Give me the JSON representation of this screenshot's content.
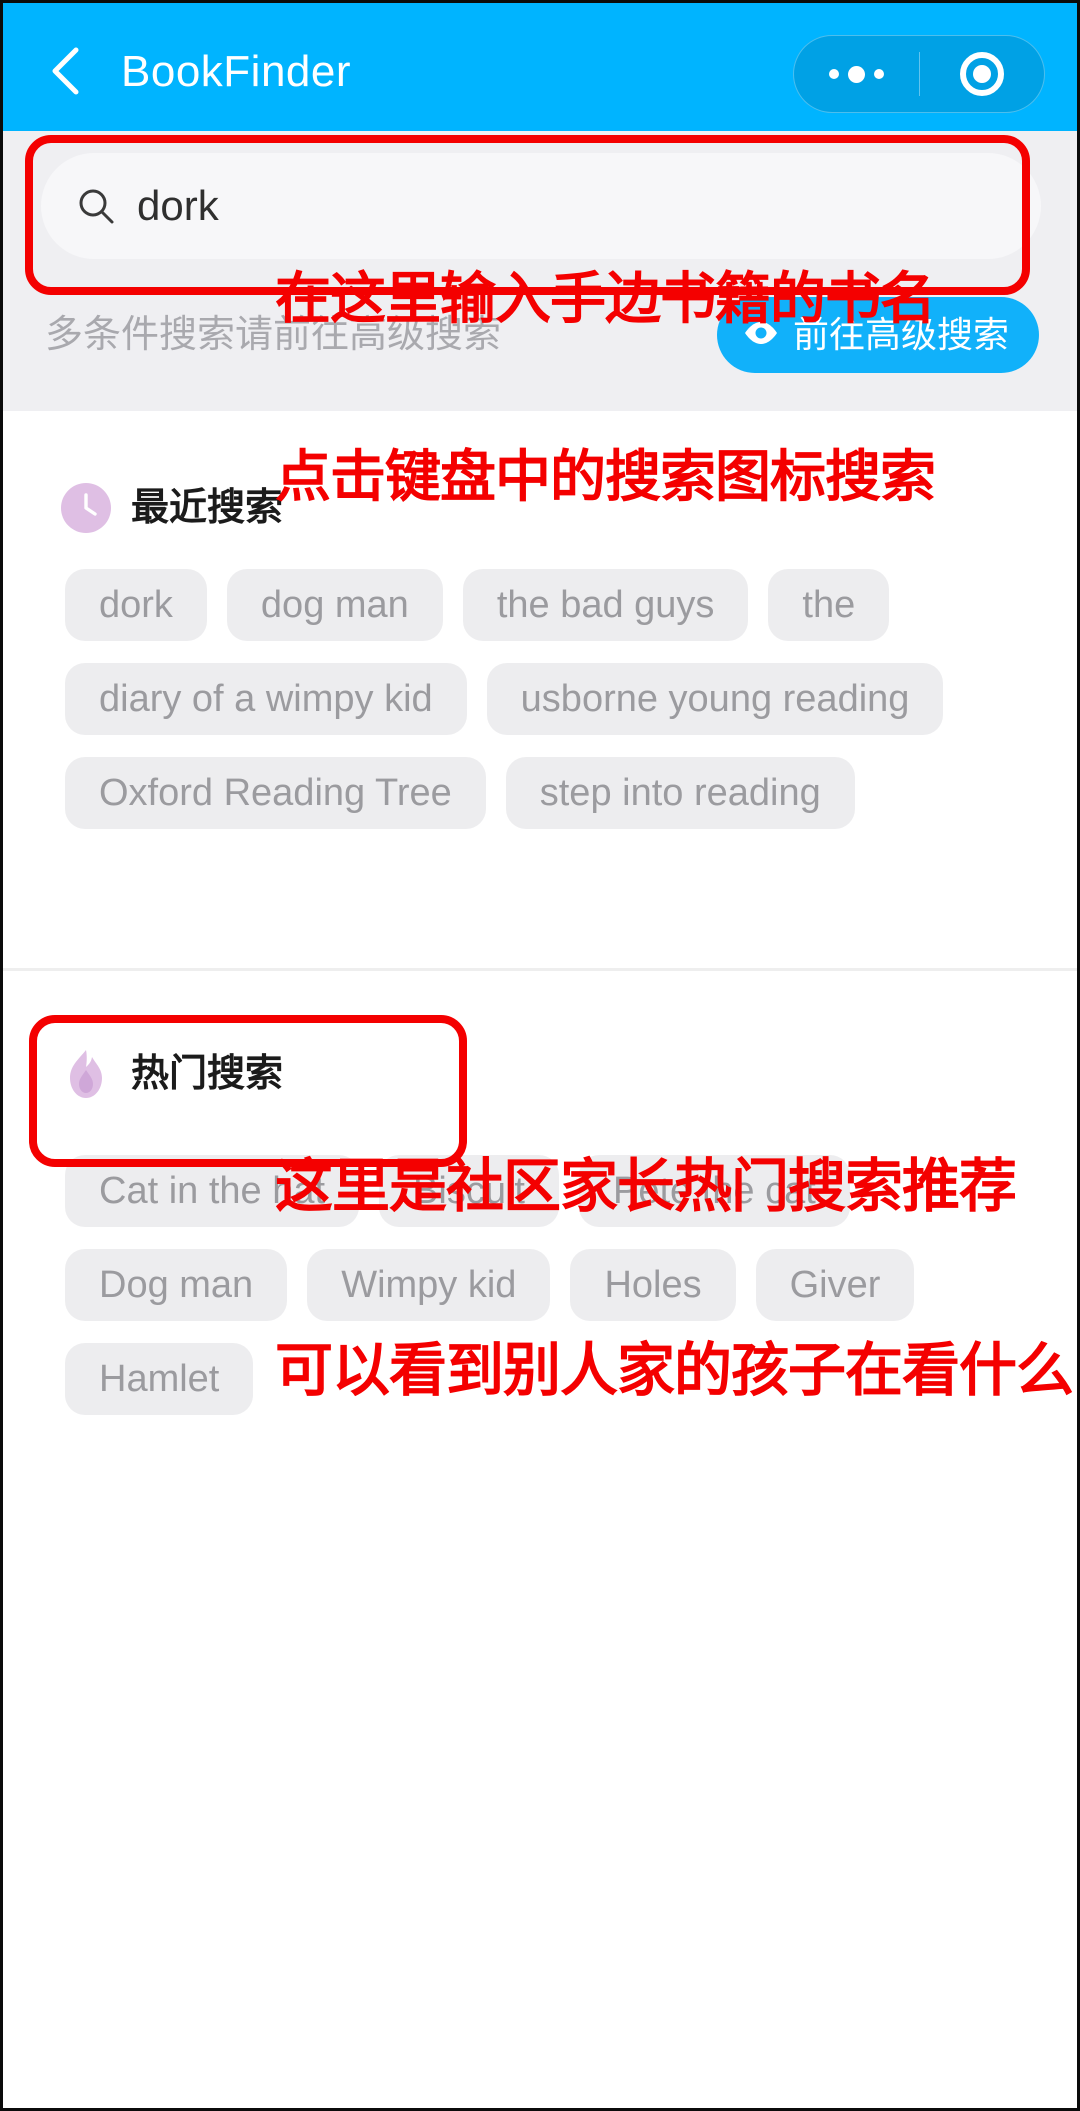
{
  "theme": {
    "nav_blue": "#00b4ff",
    "accent_blue": "#11b1fa",
    "annotation_red": "#f40000",
    "chip_bg": "#ededef",
    "chip_text": "#9b9b9f",
    "badge_purple": "#dfbfe4"
  },
  "navbar": {
    "back_icon": "chevron-left-icon",
    "title": "BookFinder",
    "capsule": {
      "more_icon": "more-dots-icon",
      "target_icon": "target-circle-icon"
    }
  },
  "search": {
    "icon": "search-icon",
    "value": "dork",
    "placeholder": "dork"
  },
  "advanced": {
    "hint": "多条件搜索请前往高级搜索",
    "button_label": "前往高级搜索",
    "button_icon": "eye-icon"
  },
  "recent": {
    "icon": "clock-icon",
    "title": "最近搜索",
    "chips": [
      "dork",
      "dog man",
      "the bad guys",
      "the",
      "diary of a wimpy kid",
      "usborne young reading",
      "Oxford Reading Tree",
      "step into reading"
    ]
  },
  "hot": {
    "icon": "flame-icon",
    "title": "热门搜索",
    "chips": [
      "Cat in the hat",
      "Biscuit",
      "Pete the cat",
      "Dog man",
      "Wimpy kid",
      "Holes",
      "Giver",
      "Hamlet"
    ]
  },
  "annotations": {
    "search": {
      "line1": "在这里输入手边书籍的书名",
      "line2": "点击键盘中的搜索图标搜索"
    },
    "hot": {
      "line1": "这里是社区家长热门搜索推荐",
      "line2": "可以看到别人家的孩子在看什么"
    }
  }
}
